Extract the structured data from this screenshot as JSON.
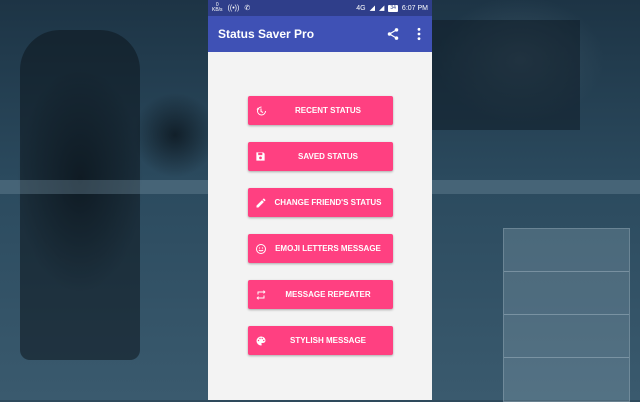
{
  "status_bar": {
    "speed_value": "0",
    "speed_unit": "KB/s",
    "network": "4G",
    "battery": "34",
    "time": "6:07 PM"
  },
  "app_bar": {
    "title": "Status Saver Pro",
    "share_icon": "share-icon",
    "overflow_icon": "more-vert-icon"
  },
  "menu": [
    {
      "label": "RECENT STATUS",
      "icon": "history-icon"
    },
    {
      "label": "SAVED STATUS",
      "icon": "save-icon"
    },
    {
      "label": "CHANGE FRIEND'S STATUS",
      "icon": "edit-icon"
    },
    {
      "label": "EMOJI LETTERS MESSAGE",
      "icon": "emoji-icon"
    },
    {
      "label": "MESSAGE REPEATER",
      "icon": "repeat-icon"
    },
    {
      "label": "STYLISH MESSAGE",
      "icon": "palette-icon"
    }
  ],
  "colors": {
    "primary": "#3f51b5",
    "primary_dark": "#2f3e8a",
    "accent": "#ff4081"
  }
}
